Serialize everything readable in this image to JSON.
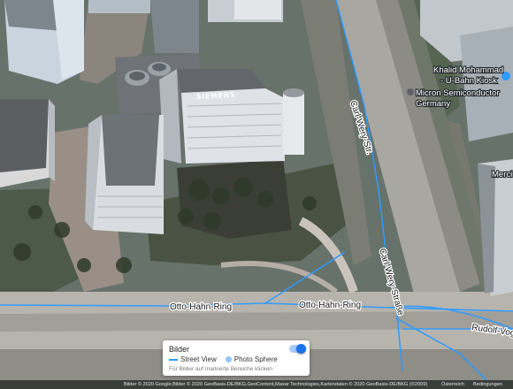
{
  "map": {
    "building_sign": "SIEMENS",
    "roads": [
      "Otto-Hahn-Ring",
      "Otto-Hahn-Ring",
      "Carl-Wery-Straße",
      "Rudolf-Vogel-",
      "Carl-Wery-Str."
    ],
    "pois": [
      {
        "name_line1": "Khalid Mohammad",
        "name_line2": "- U-Bahn Kiosk",
        "icon": "shopping-bag-icon"
      },
      {
        "name_line1": "Micron Semiconductor",
        "name_line2": "Germany",
        "icon": "map-pin-icon"
      },
      {
        "name_line1": "Merci",
        "name_line2": "",
        "icon": "map-pin-icon"
      }
    ]
  },
  "panel": {
    "title": "Bilder",
    "street_view_label": "Street View",
    "photo_sphere_label": "Photo Sphere",
    "hint": "Für Bilder auf markierte Bereiche klicken",
    "toggle_on": true
  },
  "attribution": {
    "text": "Bilder © 2020 Google,Bilder © 2020 GeoBasis-DE/BKG,GeoContent,Maxar Technologies,Kartendaten © 2020 GeoBasis-DE/BKG (©2009)",
    "country": "Österreich",
    "terms": "Bedingungen"
  },
  "colors": {
    "street_view": "#2e9bff",
    "toggle": "#1a73e8"
  }
}
